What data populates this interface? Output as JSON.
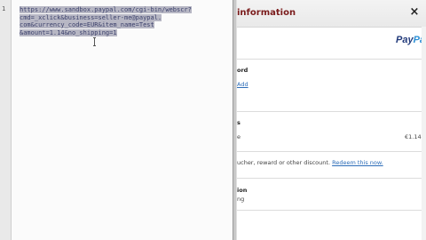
{
  "editor": {
    "line_number": "1",
    "code_lines": [
      "https://www.sandbox.paypal.com/cgi-bin/webscr?",
      "cmd=_xclick&business=seller-me@paypal.",
      "com&currency_code=EUR&item_name=Test",
      "&amount=1.14&no_shipping=1"
    ]
  },
  "paypal": {
    "header": "information",
    "close_glyph": "×",
    "logo_part1": "Pay",
    "logo_part2": "Pa",
    "section1_title": "ord",
    "section1_link": "Add",
    "section2_title": "s",
    "section2_line": "e",
    "price": "€1.14",
    "discount_text": "ucher, reward or other discount.",
    "redeem_link": "Redeem this now.",
    "section3_title": "ion",
    "section3_line": "ng"
  }
}
